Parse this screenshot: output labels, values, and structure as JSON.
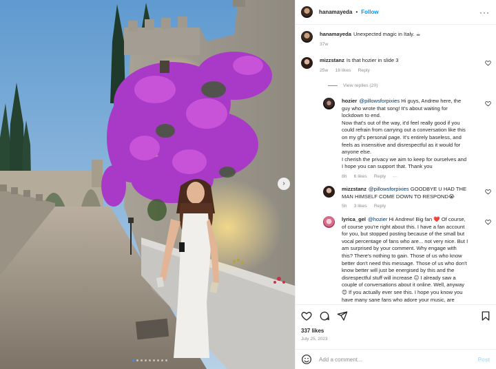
{
  "post": {
    "username": "hanamayeda",
    "follow_label": "Follow",
    "more_label": "···",
    "caption_user": "hanamayeda",
    "caption_text": "Unexpected magic in Italy. ☕",
    "caption_age": "37w"
  },
  "comments": [
    {
      "user": "mizzstanz",
      "text": "Is that hozier in slide 3",
      "age": "25w",
      "likes": "18 likes",
      "reply": "Reply",
      "view_replies": "View replies (20)"
    },
    {
      "user": "hozier",
      "mention": "@pillowsforpixies",
      "lines": [
        "Hi guys, Andrew here, the",
        "guy who wrote that song! It's about waiting for",
        "lockdown to end.",
        "Now that's out of the way, it'd feel really good if you",
        "could refrain from carrying out a conversation like this",
        "on my gf's personal page. It's entirely baseless, and",
        "feels as insensitive and disrespectful as it would for",
        "anyone else.",
        "I cherish the privacy we aim to keep for ourselves and",
        "I hope you can support that. Thank you"
      ],
      "age": "8h",
      "likes": "6 likes",
      "reply": "Reply",
      "extra": "···"
    },
    {
      "user": "mizzstanz",
      "mention": "@pillowsforpixies",
      "lines": [
        "GOODBYE U HAD THE",
        "MAN HIMSELF COME DOWN TO RESPOND😭"
      ],
      "age": "5h",
      "likes": "3 likes",
      "reply": "Reply"
    },
    {
      "user": "lyrica_gel",
      "mention": "@hozier",
      "lines": [
        "Hi Andrew! Big fan ❤️ Of course,",
        "of course you're right about this. I have a fan account",
        "for you, but stopped posting because of the small but",
        "vocal percentage of fans who are... not very nice. But I",
        "am surprised by your comment. Why engage with",
        "this? There's nothing to gain. Those of us who know",
        "better don't need this message. Those of us who don't",
        "know better will just be energised by this and the",
        "disrespectful stuff will increase 😐 I already saw a",
        "couple of conversations about it online. Well, anyway",
        "😊 If you actually ever see this. I hope you know you",
        "have many sane fans who adore your music, are"
      ]
    }
  ],
  "footer": {
    "likes": "337 likes",
    "date": "July 25, 2023",
    "add_comment_placeholder": "Add a comment...",
    "post_label": "Post"
  },
  "carousel": {
    "count": 9,
    "active_index": 0,
    "next_glyph": "›"
  },
  "colors": {
    "link_blue": "#0095f6",
    "mention_blue": "#00376b",
    "muted_gray": "#8e8e8e",
    "carousel_dot_active": "#3b8ef0"
  },
  "icons": [
    "more-icon",
    "heart-icon",
    "comment-icon",
    "share-icon",
    "save-icon",
    "emoji-icon",
    "next-arrow-icon"
  ]
}
